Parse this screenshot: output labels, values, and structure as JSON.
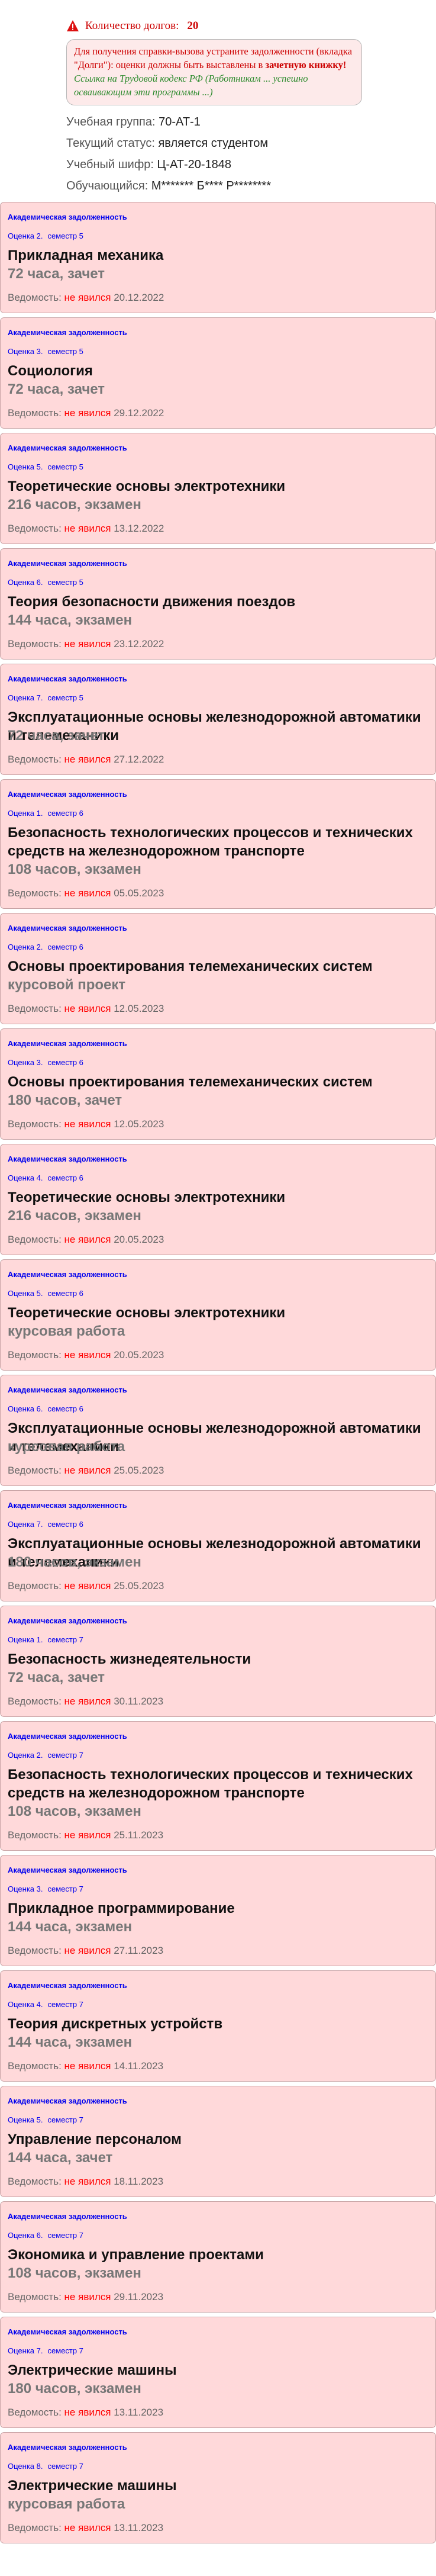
{
  "debts": {
    "label": "Количество долгов:",
    "count": "20"
  },
  "notice": {
    "red_part": "Для получения справки-вызова устраните задолженности (вкладка \"Долги\"): оценки должны быть выставлены в",
    "bold_part": "зачетную книжку!",
    "green_part": "Ссылка на Трудовой кодекс РФ (Работникам ... успешно осваивающим эти программы ...)"
  },
  "info": [
    {
      "label": "Учебная группа:",
      "value": "70-АТ-1"
    },
    {
      "label": "Текущий статус:",
      "value": "является студентом"
    },
    {
      "label": "Учебный шифр:",
      "value": "Ц-АТ-20-1848"
    },
    {
      "label": "Обучающийся:",
      "value": "М******* Б**** Р********"
    }
  ],
  "record_tag": "Академическая задолженность",
  "ledger_label": "Ведомость:",
  "cards": [
    {
      "grade": "Оценка 2.",
      "semester": "семестр 5",
      "title": "Прикладная механика",
      "hours": "72 часа, зачет",
      "status": "не явился",
      "date": "20.12.2022"
    },
    {
      "grade": "Оценка 3.",
      "semester": "семестр 5",
      "title": "Социология",
      "hours": "72 часа, зачет",
      "status": "не явился",
      "date": "29.12.2022"
    },
    {
      "grade": "Оценка 5.",
      "semester": "семестр 5",
      "title": "Теоретические основы электротехники",
      "hours": "216 часов, экзамен",
      "status": "не явился",
      "date": "13.12.2022"
    },
    {
      "grade": "Оценка 6.",
      "semester": "семестр 5",
      "title": "Теория безопасности движения поездов",
      "hours": "144 часа, экзамен",
      "status": "не явился",
      "date": "23.12.2022"
    },
    {
      "grade": "Оценка 7.",
      "semester": "семестр 5",
      "title": "Эксплуатационные основы железнодорожной автоматики и телемеханики",
      "hours": "72 часа, зачет",
      "status": "не явился",
      "date": "27.12.2022"
    },
    {
      "grade": "Оценка 1.",
      "semester": "семестр 6",
      "title": "Безопасность технологических процессов и технических средств на железнодорожном транспорте",
      "hours": "108 часов, экзамен",
      "status": "не явился",
      "date": "05.05.2023"
    },
    {
      "grade": "Оценка 2.",
      "semester": "семестр 6",
      "title": "Основы проектирования телемеханических систем",
      "hours": "курсовой проект",
      "status": "не явился",
      "date": "12.05.2023"
    },
    {
      "grade": "Оценка 3.",
      "semester": "семестр 6",
      "title": "Основы проектирования телемеханических систем",
      "hours": "180 часов, зачет",
      "status": "не явился",
      "date": "12.05.2023"
    },
    {
      "grade": "Оценка 4.",
      "semester": "семестр 6",
      "title": "Теоретические основы электротехники",
      "hours": "216 часов, экзамен",
      "status": "не явился",
      "date": "20.05.2023"
    },
    {
      "grade": "Оценка 5.",
      "semester": "семестр 6",
      "title": "Теоретические основы электротехники",
      "hours": "курсовая работа",
      "status": "не явился",
      "date": "20.05.2023"
    },
    {
      "grade": "Оценка 6.",
      "semester": "семестр 6",
      "title": "Эксплуатационные основы железнодорожной автоматики и телемеханики",
      "hours": "курсовая работа",
      "status": "не явился",
      "date": "25.05.2023"
    },
    {
      "grade": "Оценка 7.",
      "semester": "семестр 6",
      "title": "Эксплуатационные основы железнодорожной автоматики и телемеханики",
      "hours": "180 часов, экзамен",
      "status": "не явился",
      "date": "25.05.2023"
    },
    {
      "grade": "Оценка 1.",
      "semester": "семестр 7",
      "title": "Безопасность жизнедеятельности",
      "hours": "72 часа, зачет",
      "status": "не явился",
      "date": "30.11.2023"
    },
    {
      "grade": "Оценка 2.",
      "semester": "семестр 7",
      "title": "Безопасность технологических процессов и технических средств на железнодорожном транспорте",
      "hours": "108 часов, экзамен",
      "status": "не явился",
      "date": "25.11.2023"
    },
    {
      "grade": "Оценка 3.",
      "semester": "семестр 7",
      "title": "Прикладное программирование",
      "hours": "144 часа, экзамен",
      "status": "не явился",
      "date": "27.11.2023"
    },
    {
      "grade": "Оценка 4.",
      "semester": "семестр 7",
      "title": "Теория дискретных устройств",
      "hours": "144 часа, экзамен",
      "status": "не явился",
      "date": "14.11.2023"
    },
    {
      "grade": "Оценка 5.",
      "semester": "семестр 7",
      "title": "Управление персоналом",
      "hours": "144 часа, зачет",
      "status": "не явился",
      "date": "18.11.2023"
    },
    {
      "grade": "Оценка 6.",
      "semester": "семестр 7",
      "title": "Экономика и управление проектами",
      "hours": "108 часов, экзамен",
      "status": "не явился",
      "date": "29.11.2023"
    },
    {
      "grade": "Оценка 7.",
      "semester": "семестр 7",
      "title": "Электрические машины",
      "hours": "180 часов, экзамен",
      "status": "не явился",
      "date": "13.11.2023"
    },
    {
      "grade": "Оценка 8.",
      "semester": "семестр 7",
      "title": "Электрические машины",
      "hours": "курсовая работа",
      "status": "не явился",
      "date": "13.11.2023"
    }
  ],
  "colors": {
    "card_bg": "#ffd9da",
    "link_blue": "#0000ee",
    "status_red": "#ff0000",
    "warning_red": "#cc0000"
  }
}
